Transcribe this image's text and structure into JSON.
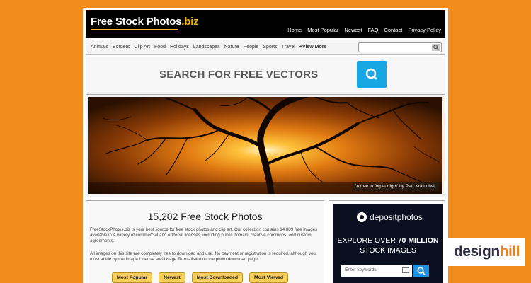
{
  "site": {
    "logo_main": "Free Stock Photos",
    "logo_ext": ".biz",
    "nav": [
      "Home",
      "Most Popular",
      "Newest",
      "FAQ",
      "Contact",
      "Privacy Policy"
    ]
  },
  "categories": [
    "Animals",
    "Borders",
    "Clip Art",
    "Food",
    "Holidays",
    "Landscapes",
    "Nature",
    "People",
    "Sports",
    "Travel",
    "+View More"
  ],
  "search": {
    "value": "",
    "icon": "search-icon"
  },
  "ad": {
    "text": "SEARCH FOR FREE VECTORS",
    "close": "ⓘ✕"
  },
  "hero": {
    "caption": "'A tree in fog at night' by Petr Kratochvil"
  },
  "main": {
    "title": "15,202 Free Stock Photos",
    "desc1": "FreeStockPhotos.biz is your best source for free stock photos and clip art. Our collection contains 14,889 free images available in a variety of commercial and editorial licenses, including public domain, creative commons, and custom agreements.",
    "desc2": "All images on this site are completely free to download and use. No payment or registration is required, although you must abide by the Image License and Usage Terms listed on the photo download page.",
    "buttons": [
      "Most Popular",
      "Newest",
      "Most Downloaded",
      "Most Viewed"
    ]
  },
  "side_ad": {
    "logo": "depositphotos",
    "line1a": "EXPLORE OVER ",
    "line1b": "70 MILLION",
    "line2": "STOCK IMAGES",
    "placeholder": "Enter keywords"
  },
  "watermark": {
    "part1": "design",
    "part2": "hill"
  },
  "colors": {
    "background": "#f28c1c",
    "accent": "#f2b51c",
    "button": "#f4cf5a",
    "ad_blue": "#17a8e3"
  }
}
